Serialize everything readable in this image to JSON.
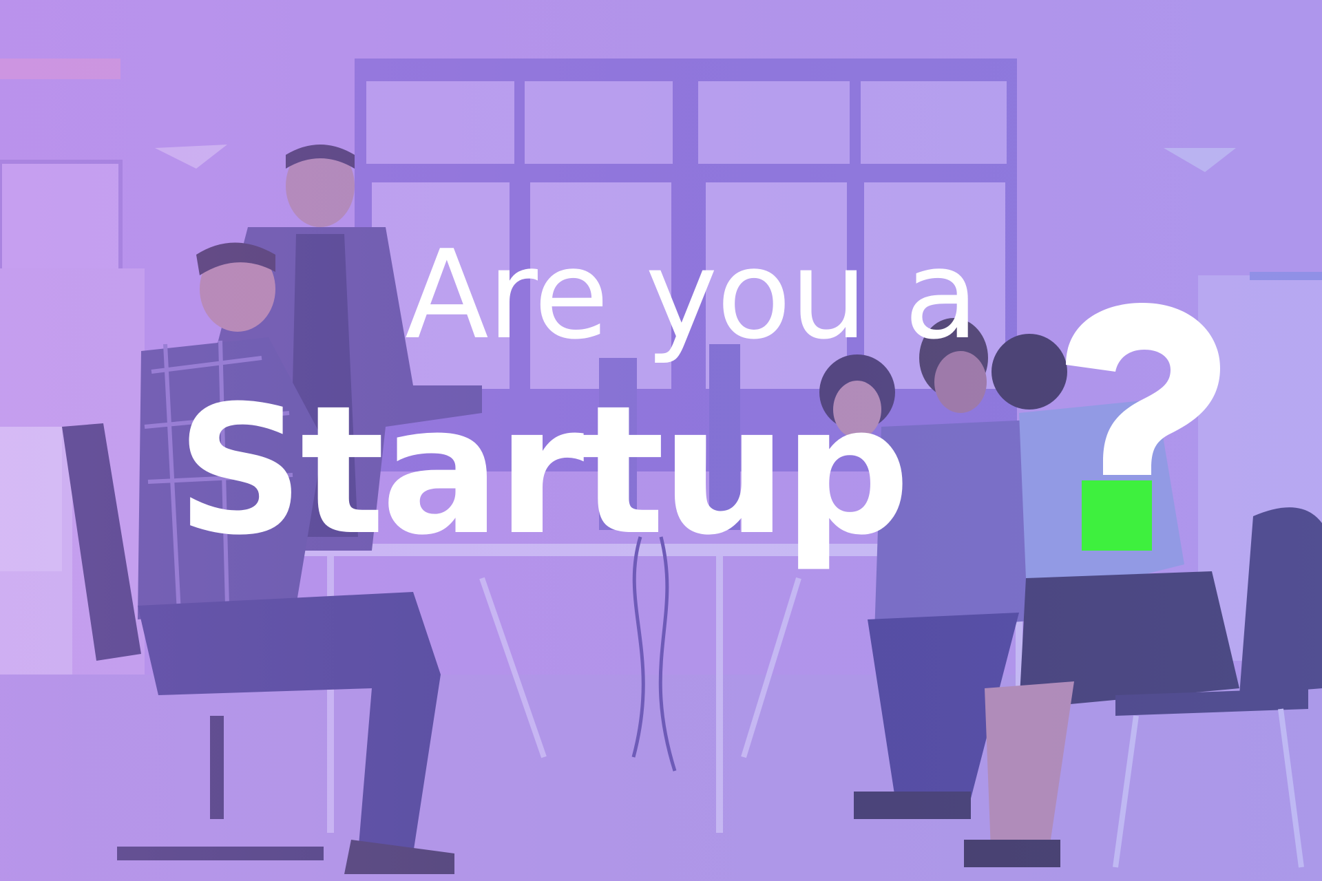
{
  "headline": {
    "line1": "Are you a",
    "line2": "Startup"
  },
  "colors": {
    "text": "#ffffff",
    "accent": "#3ef03e",
    "overlay": "#a98fe6"
  },
  "icons": {
    "question_mark": "question-mark-icon"
  }
}
